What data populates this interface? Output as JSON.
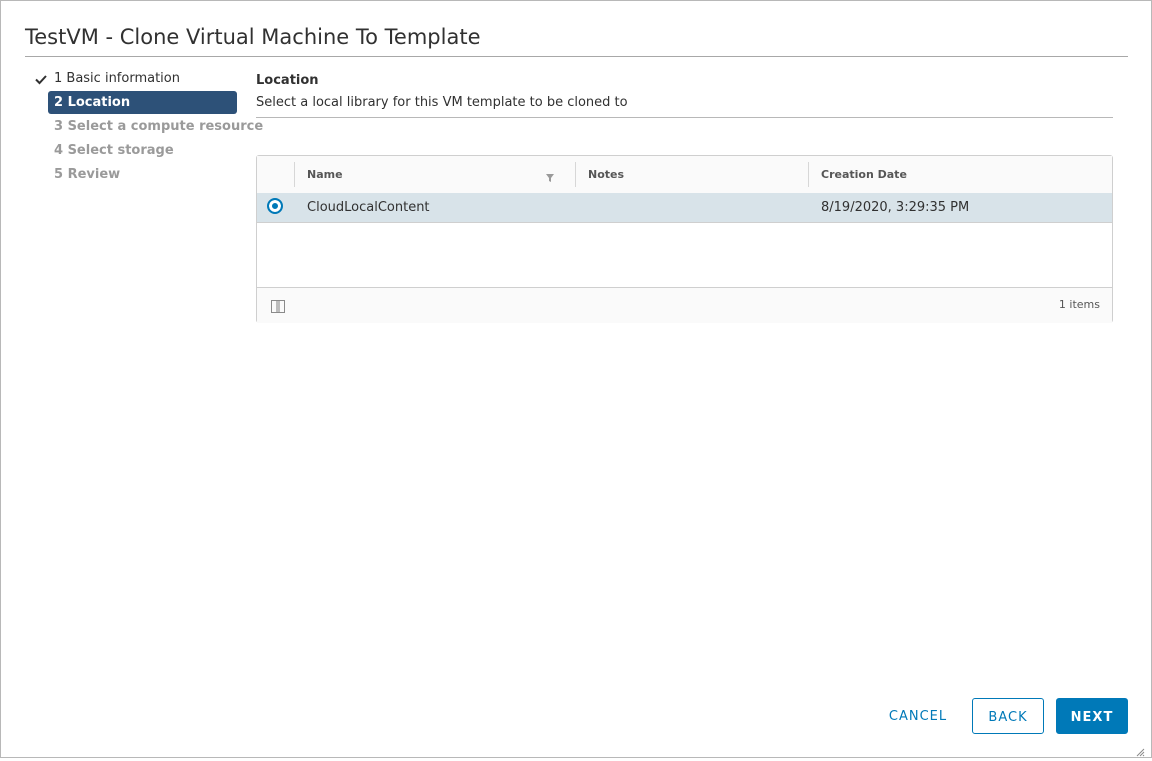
{
  "dialog": {
    "title": "TestVM - Clone Virtual Machine To Template"
  },
  "steps": [
    {
      "label": "1 Basic information",
      "state": "done"
    },
    {
      "label": "2 Location",
      "state": "active"
    },
    {
      "label": "3 Select a compute resource",
      "state": "pending"
    },
    {
      "label": "4 Select storage",
      "state": "pending"
    },
    {
      "label": "5 Review",
      "state": "pending"
    }
  ],
  "content": {
    "title": "Location",
    "description": "Select a local library for this VM template to be cloned to"
  },
  "grid": {
    "columns": [
      "Name",
      "Notes",
      "Creation Date"
    ],
    "rows": [
      {
        "selected": true,
        "name": "CloudLocalContent",
        "notes": "",
        "creation_date": "8/19/2020, 3:29:35 PM"
      }
    ],
    "footer": {
      "items_count": "1 items"
    }
  },
  "buttons": {
    "cancel": "CANCEL",
    "back": "BACK",
    "next": "NEXT"
  },
  "colors": {
    "accent": "#0079b8",
    "active_step": "#2d5178",
    "selected_row": "#d8e3e9"
  }
}
